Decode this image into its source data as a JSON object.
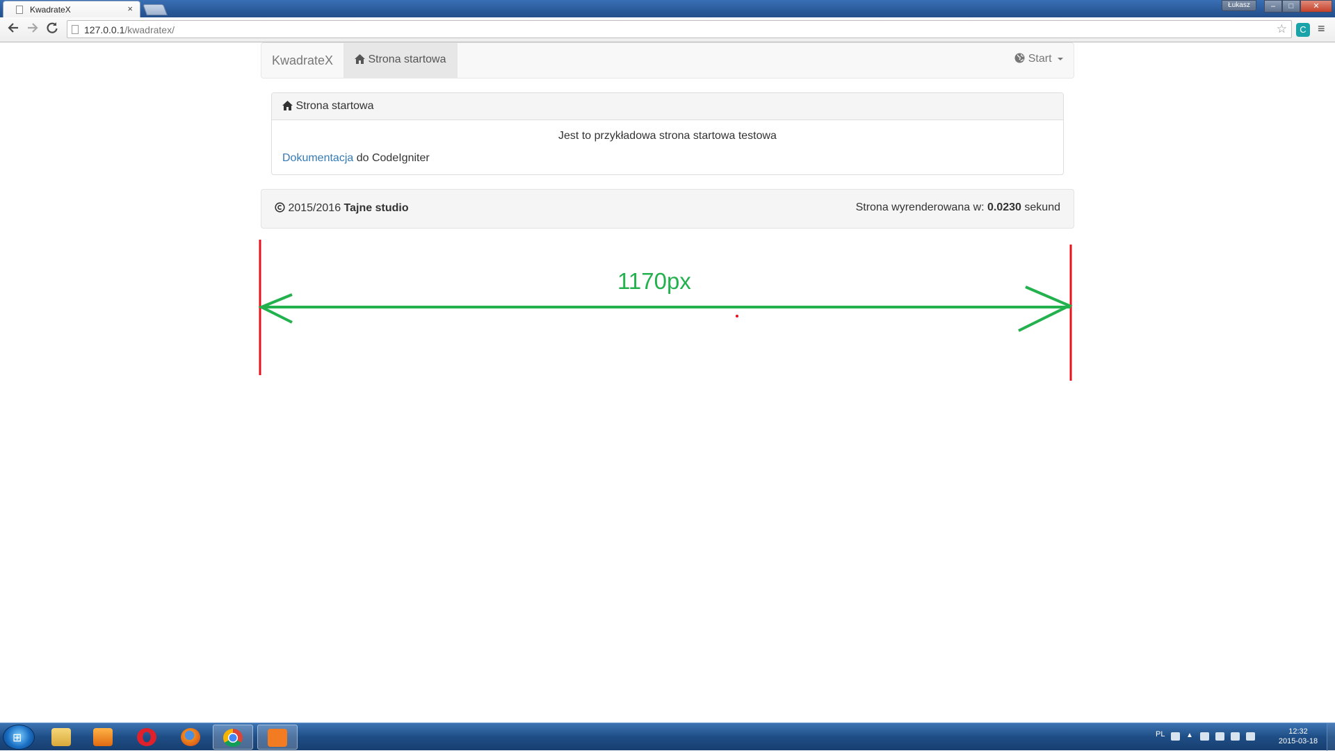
{
  "browser": {
    "tab_title": "KwadrateX",
    "tab_close": "×",
    "user_badge": "Łukasz",
    "url_host": "127.0.0.1",
    "url_path": "/kwadratex/",
    "window_minimize": "–",
    "window_maximize": "□",
    "window_close": "✕"
  },
  "navbar": {
    "brand": "KwadrateX",
    "active_item": "Strona startowa",
    "right_dropdown": "Start"
  },
  "panel": {
    "heading": "Strona startowa",
    "body_text": "Jest to przykładowa strona startowa testowa",
    "doc_link": "Dokumentacja",
    "doc_suffix": " do CodeIgniter"
  },
  "footer": {
    "years": "2015/2016",
    "studio": "Tajne studio",
    "render_prefix": "Strona wyrenderowana w: ",
    "render_time": "0.0230",
    "render_suffix": " sekund"
  },
  "annotation": {
    "width_label": "1170px",
    "colors": {
      "arrow": "#22b14c",
      "bounds": "#e8101c"
    }
  },
  "taskbar": {
    "language": "PL",
    "time": "12:32",
    "date": "2015-03-18",
    "apps": [
      "windows-explorer",
      "media-player",
      "opera",
      "firefox",
      "chrome",
      "xampp"
    ]
  }
}
